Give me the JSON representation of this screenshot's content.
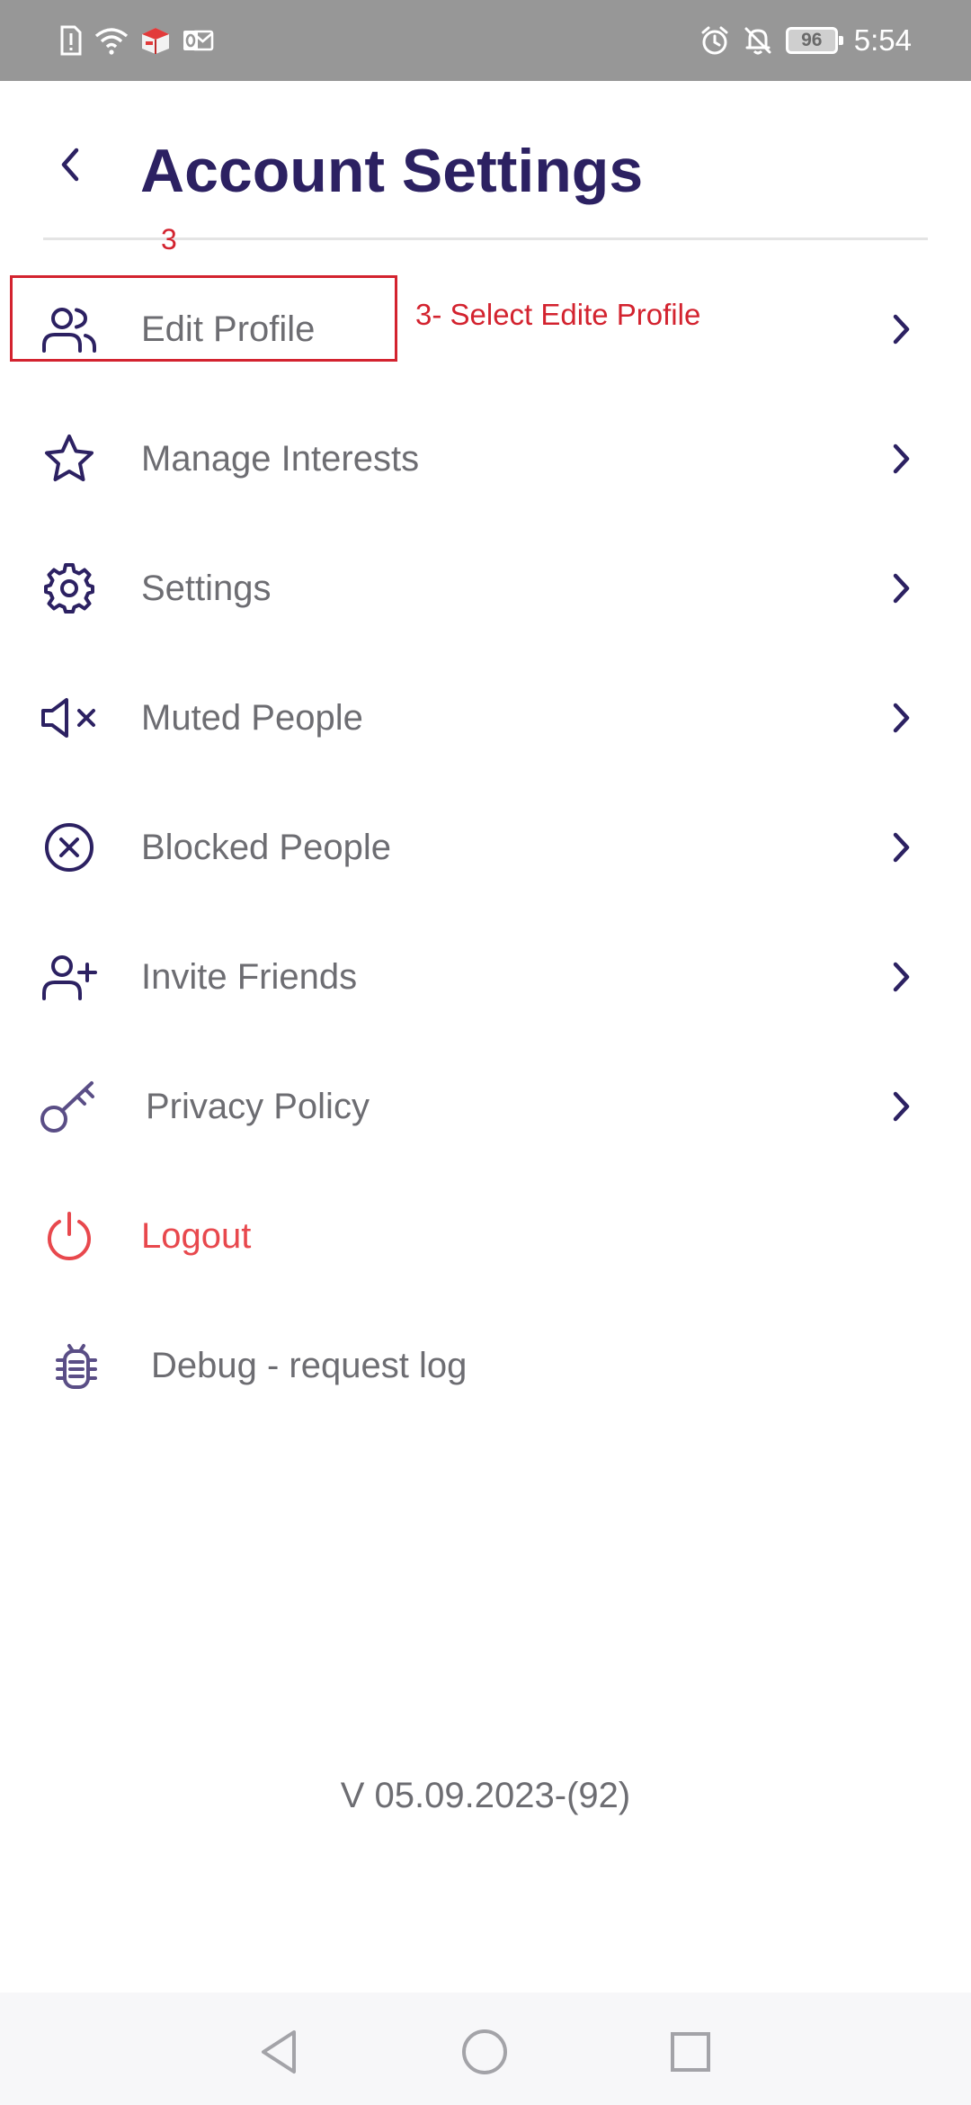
{
  "status_bar": {
    "time": "5:54",
    "battery": "96",
    "left_icons": [
      "sim-alert-icon",
      "wifi-icon",
      "app-notification-icon",
      "outlook-icon"
    ],
    "right_icons": [
      "alarm-icon",
      "mute-icon"
    ]
  },
  "header": {
    "title": "Account Settings",
    "back_icon": "chevron-left-icon"
  },
  "menu": {
    "items": [
      {
        "label": "Edit Profile",
        "icon": "users-icon",
        "has_chevron": true
      },
      {
        "label": "Manage Interests",
        "icon": "star-icon",
        "has_chevron": true
      },
      {
        "label": "Settings",
        "icon": "gear-icon",
        "has_chevron": true
      },
      {
        "label": "Muted People",
        "icon": "speaker-mute-icon",
        "has_chevron": true
      },
      {
        "label": "Blocked People",
        "icon": "circle-x-icon",
        "has_chevron": true
      },
      {
        "label": "Invite Friends",
        "icon": "user-plus-icon",
        "has_chevron": true
      },
      {
        "label": "Privacy Policy",
        "icon": "key-icon",
        "has_chevron": true
      },
      {
        "label": "Logout",
        "icon": "power-icon",
        "has_chevron": false
      },
      {
        "label": "Debug - request log",
        "icon": "bug-icon",
        "has_chevron": false
      }
    ]
  },
  "annotation": {
    "step": "3",
    "note": "3- Select Edite Profile"
  },
  "footer": {
    "version": "V 05.09.2023-(92)"
  },
  "nav_bar": {
    "buttons": [
      "back-triangle-icon",
      "home-circle-icon",
      "recents-square-icon"
    ]
  },
  "colors": {
    "title": "#2c2162",
    "icon": "#2c2162",
    "label": "#6d6d72",
    "logout": "#e8484d",
    "annotation": "#d3232f",
    "status_bar_bg": "#979797"
  }
}
